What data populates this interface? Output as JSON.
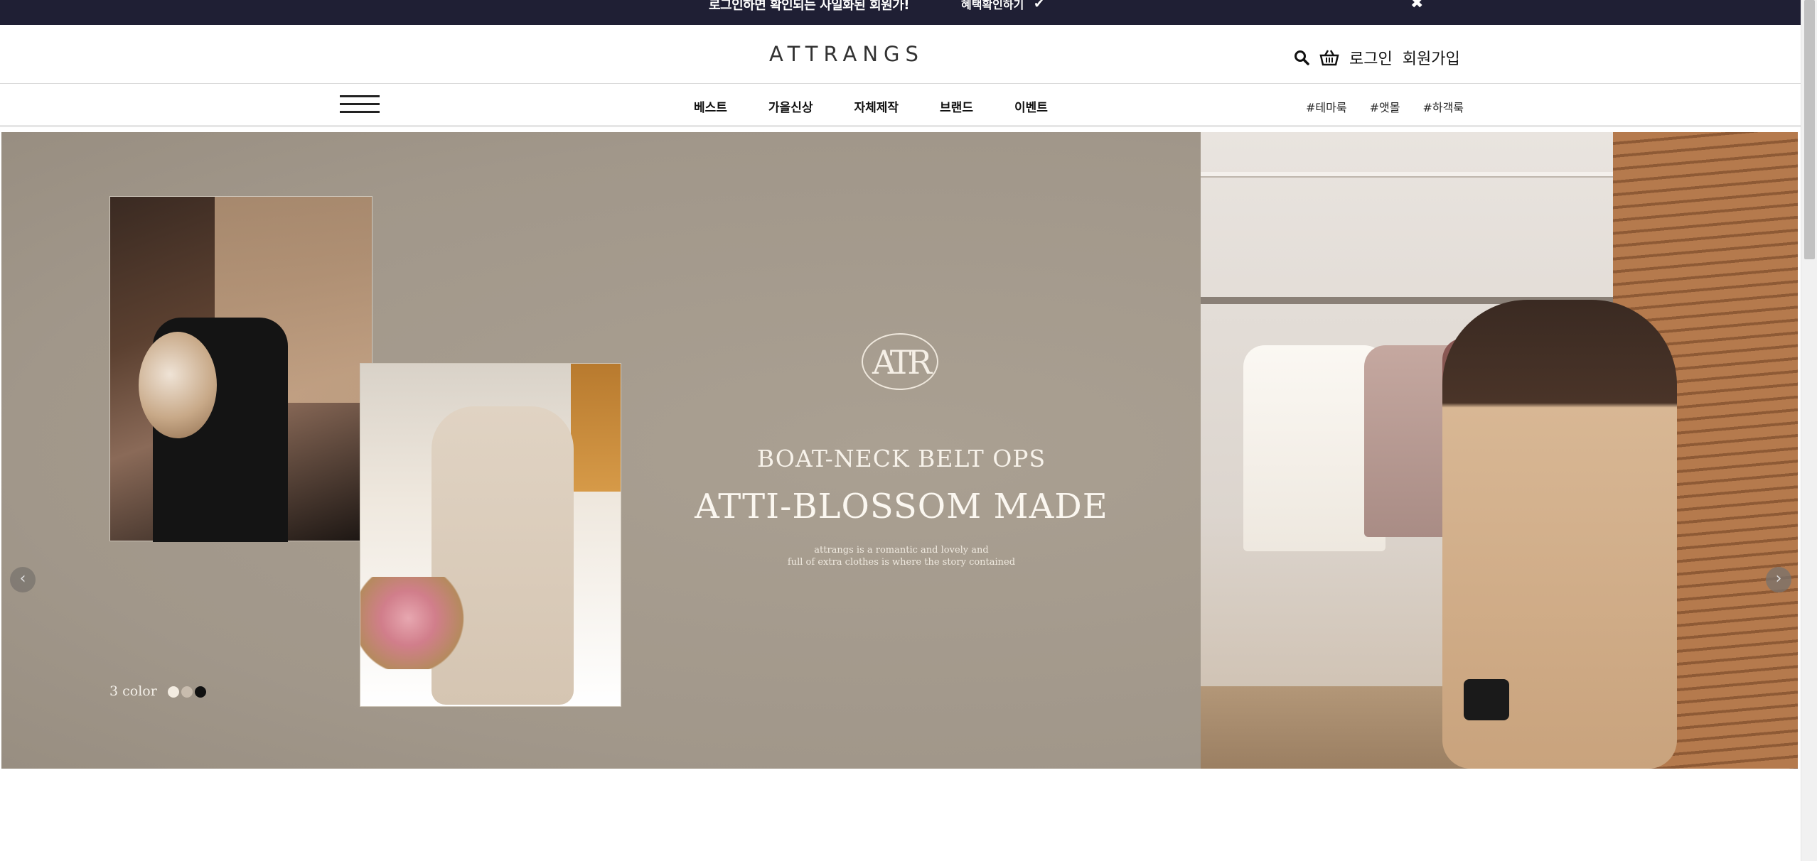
{
  "topbar": {
    "message": "로그인하면 확인되는 사일화된 회원가!",
    "benefit_label": "혜택확인하기",
    "check_glyph": "✔",
    "close_glyph": "✖"
  },
  "header": {
    "logo": "ATTRANGS",
    "login_label": "로그인",
    "join_label": "회원가입"
  },
  "nav": {
    "menu": [
      "베스트",
      "가을신상",
      "자체제작",
      "브랜드",
      "이벤트"
    ],
    "tags": [
      "#테마룩",
      "#앳몰",
      "#하객룩"
    ]
  },
  "banner": {
    "emblem": "ATR",
    "subtitle": "BOAT-NECK BELT OPS",
    "title": "ATTI-BLOSSOM MADE",
    "desc_line1": "attrangs is a romantic and lovely and",
    "desc_line2": "full of extra clothes is where the story contained",
    "color_label": "3 color",
    "swatch_colors": [
      "#f3ece1",
      "#c8bcae",
      "#111111"
    ],
    "prev_glyph": "‹",
    "next_glyph": "›"
  }
}
